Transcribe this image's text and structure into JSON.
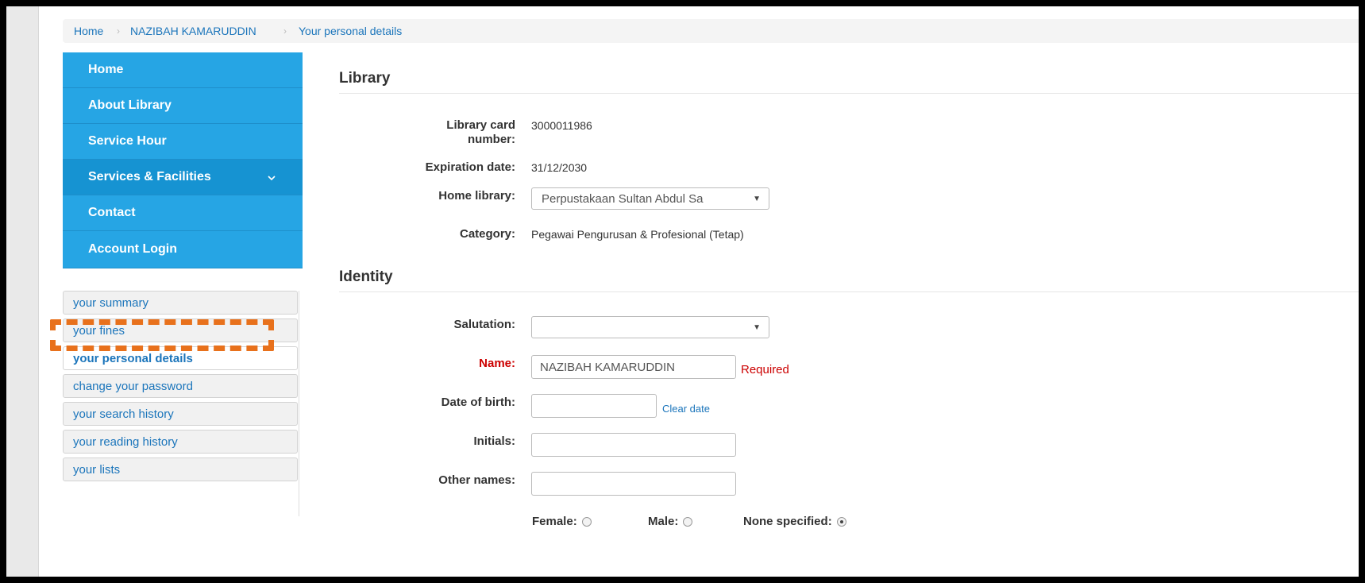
{
  "breadcrumb": [
    "Home",
    "NAZIBAH KAMARUDDIN",
    "Your personal details"
  ],
  "nav": [
    {
      "label": "Home"
    },
    {
      "label": "About Library"
    },
    {
      "label": "Service Hour"
    },
    {
      "label": "Services & Facilities"
    },
    {
      "label": "Contact"
    },
    {
      "label": "Account Login"
    }
  ],
  "subnav": [
    {
      "label": "your summary"
    },
    {
      "label": "your fines"
    },
    {
      "label": "your personal details"
    },
    {
      "label": "change your password"
    },
    {
      "label": "your search history"
    },
    {
      "label": "your reading history"
    },
    {
      "label": "your lists"
    }
  ],
  "library": {
    "heading": "Library",
    "card_label_line1": "Library card",
    "card_label_line2": "number:",
    "card_value": "3000011986",
    "expiration_label": "Expiration date:",
    "expiration_value": "31/12/2030",
    "home_label": "Home library:",
    "home_value": "Perpustakaan Sultan Abdul Sa",
    "category_label": "Category:",
    "category_value": "Pegawai Pengurusan & Profesional (Tetap)"
  },
  "identity": {
    "heading": "Identity",
    "salutation_label": "Salutation:",
    "salutation_value": "",
    "name_label": "Name:",
    "name_value": "NAZIBAH KAMARUDDIN",
    "name_required": "Required",
    "dob_label": "Date of birth:",
    "dob_value": "",
    "clear_date": "Clear date",
    "initials_label": "Initials:",
    "initials_value": "",
    "other_names_label": "Other names:",
    "other_names_value": "",
    "gender_female": "Female:",
    "gender_male": "Male:",
    "gender_none": "None specified:",
    "gender_selected": "None specified"
  },
  "colors": {
    "nav_blue": "#26a5e4",
    "link_blue": "#1b75bb",
    "required_red": "#cc0000",
    "highlight_orange": "#e8711c"
  }
}
